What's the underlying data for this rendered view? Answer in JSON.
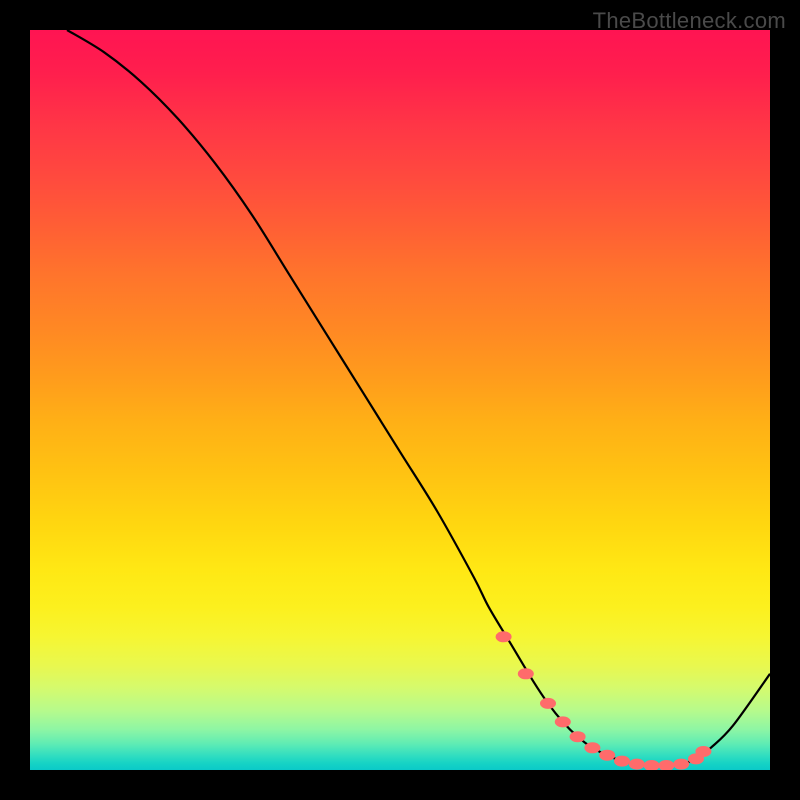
{
  "watermark": "TheBottleneck.com",
  "chart_data": {
    "type": "line",
    "title": "",
    "xlabel": "",
    "ylabel": "",
    "xlim": [
      0,
      100
    ],
    "ylim": [
      0,
      100
    ],
    "series": [
      {
        "name": "bottleneck-curve",
        "x": [
          5,
          10,
          15,
          20,
          25,
          30,
          35,
          40,
          45,
          50,
          55,
          60,
          62,
          65,
          68,
          70,
          72,
          74,
          76,
          78,
          80,
          82,
          84,
          86,
          88,
          90,
          92,
          95,
          100
        ],
        "y": [
          100,
          97,
          93,
          88,
          82,
          75,
          67,
          59,
          51,
          43,
          35,
          26,
          22,
          17,
          12,
          9,
          6.5,
          4.5,
          3,
          2,
          1.2,
          0.8,
          0.6,
          0.6,
          0.8,
          1.5,
          3,
          6,
          13
        ]
      }
    ],
    "markers": {
      "name": "highlighted-points",
      "x": [
        64,
        67,
        70,
        72,
        74,
        76,
        78,
        80,
        82,
        84,
        86,
        88,
        90,
        91
      ],
      "y": [
        18,
        13,
        9,
        6.5,
        4.5,
        3,
        2,
        1.2,
        0.8,
        0.6,
        0.6,
        0.8,
        1.5,
        2.5
      ]
    },
    "background": "heatmap-gradient-red-yellow-green",
    "grid": false
  }
}
